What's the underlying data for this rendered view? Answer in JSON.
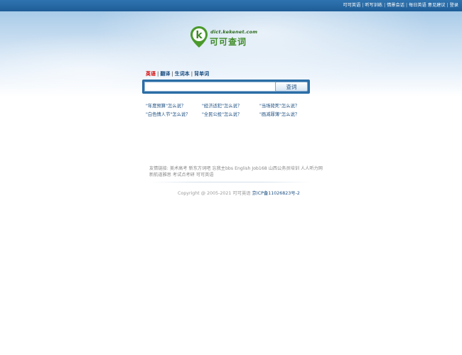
{
  "topnav": {
    "items": [
      "可可英语",
      "听写训练",
      "情景会话",
      "每日英语",
      "意见建议",
      "登录"
    ]
  },
  "logo": {
    "letter": "k",
    "domain": "dict.kekenet.com",
    "brand": "可可查词"
  },
  "tabs": [
    "英语",
    "翻译",
    "生词本",
    "背单词"
  ],
  "search": {
    "value": "",
    "placeholder": "",
    "button": "查词"
  },
  "suggestions": [
    "\"年度预算\"怎么说？",
    "\"经济适犯\"怎么说？",
    "\"当场毙死\"怎么说？",
    "\"白色情人节\"怎么说？",
    "\"全民公投\"怎么说？",
    "\"画减罪薄\"怎么说？"
  ],
  "friend_links": {
    "label": "友情链接:",
    "items": [
      "美术高考",
      "新东方词吧",
      "忘我主bbs",
      "English",
      "Job168",
      "山西公务员培训",
      "人人听力网",
      "新航道雅思",
      "考试点考研",
      "可可英语"
    ]
  },
  "footer": {
    "text": "Copyright @ 2005-2021 可可英语",
    "icp": "京ICP备11026823号-2"
  },
  "colors": {
    "topbar": "#2266a4",
    "tab_active": "#d40000",
    "link": "#1a4d80",
    "logo_green": "#3e8a26"
  }
}
